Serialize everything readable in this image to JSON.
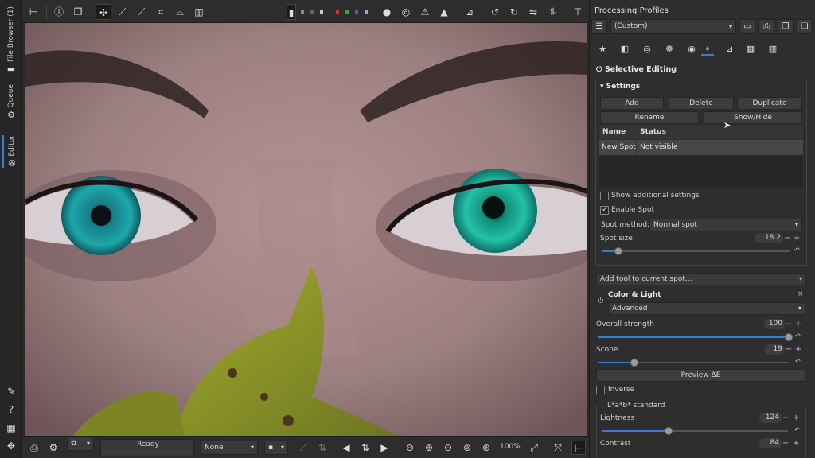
{
  "left_bar": {
    "tabs": [
      {
        "label": "File Browser (1)",
        "icon": "folder-icon"
      },
      {
        "label": "Queue",
        "icon": "gears-icon"
      },
      {
        "label": "Editor",
        "icon": "aperture-icon"
      }
    ],
    "bottom_icons": [
      "pen-icon",
      "help-icon",
      "grid-icon",
      "move-icon"
    ]
  },
  "top_toolbar": {
    "icons": [
      "compare-icon",
      "info-icon",
      "before-after-icon",
      "hand-icon",
      "picker-icon",
      "white-balance-icon",
      "crop-icon",
      "straighten-icon",
      "perspective-icon",
      "spot-icon",
      "rgb-dots-icon",
      "focus-mask-icon",
      "shadow-clip-icon",
      "warning-icon",
      "warning-filled-icon",
      "histogram-icon",
      "rotate-left-icon",
      "rotate-right-icon",
      "flip-h-icon",
      "flip-v-icon",
      "panel-toggle-icon"
    ]
  },
  "bottom_toolbar": {
    "status": "Ready",
    "color_label": "None",
    "zoom": "100%"
  },
  "right_panel": {
    "title": "Processing Profiles",
    "profile": "(Custom)",
    "section": "Selective Editing",
    "settings": {
      "title": "Settings",
      "buttons": [
        "Add",
        "Delete",
        "Duplicate",
        "Rename",
        "Show/Hide"
      ],
      "columns": [
        "Name",
        "Status"
      ],
      "rows": [
        {
          "name": "New Spot",
          "status": "Not visible"
        }
      ],
      "show_additional": "Show additional settings",
      "enable_spot": "Enable Spot",
      "spot_method_label": "Spot method:",
      "spot_method": "Normal spot",
      "spot_size_label": "Spot size",
      "spot_size": "18.2",
      "spot_size_fraction": 0.09
    },
    "add_tool": "Add tool to current spot...",
    "color_light": {
      "title": "Color & Light",
      "mode": "Advanced",
      "overall_strength_label": "Overall strength",
      "overall_strength": "100",
      "overall_strength_fraction": 1.0,
      "scope_label": "Scope",
      "scope": "19",
      "scope_fraction": 0.19,
      "preview_button": "Preview ΔE",
      "inverse": "Inverse",
      "lab_group": "L*a*b* standard",
      "lightness_label": "Lightness",
      "lightness": "124",
      "lightness_fraction": 0.36,
      "contrast_label": "Contrast",
      "contrast": "84"
    }
  },
  "colors": {
    "accent": "#3a7bd5",
    "panel": "#2e2e2e",
    "iris": "#1fa5a5"
  }
}
